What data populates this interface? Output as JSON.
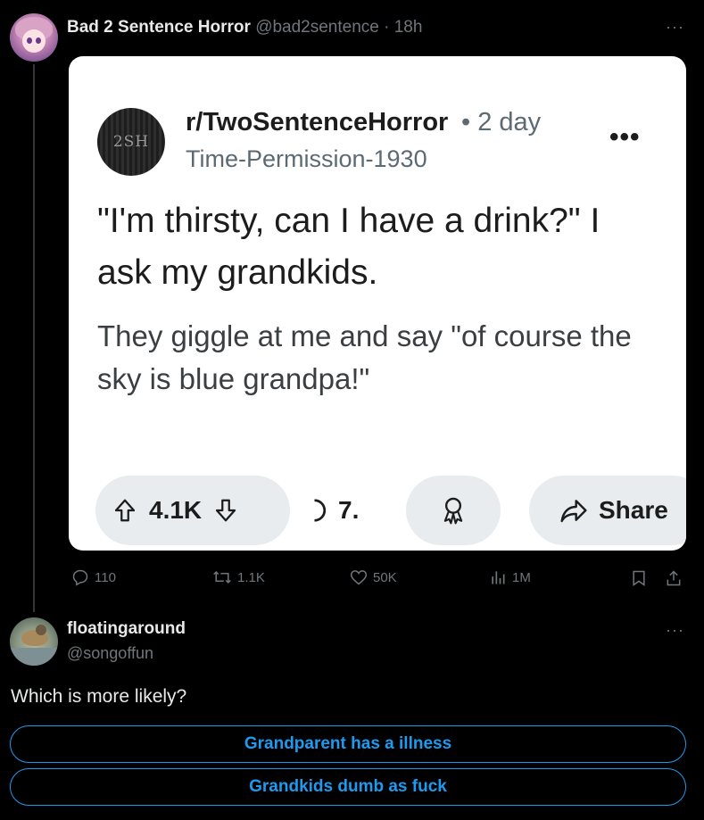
{
  "tweet": {
    "display_name": "Bad 2 Sentence Horror",
    "meta": "@bad2sentence · 18h",
    "more_label": "···",
    "image_card": {
      "subreddit": "r/TwoSentenceHorror",
      "time": "• 2 day",
      "username": "Time-Permission-1930",
      "icon_text": "2SH",
      "more_label": "•••",
      "title": "\"I'm thirsty, can I have a drink?\" I ask my grandkids.",
      "body": "They giggle at me and say \"of course the sky is blue grandpa!\"",
      "vote_count": "4.1K",
      "comment_count": "7.",
      "share_label": "Share"
    },
    "actions": {
      "replies": "110",
      "retweets": "1.1K",
      "likes": "50K",
      "views": "1M"
    }
  },
  "reply": {
    "display_name": "floatingaround",
    "handle": "@songoffun",
    "more_label": "···",
    "text": "Which is more likely?",
    "poll_options": [
      "Grandparent has a illness",
      "Grandkids dumb as fuck"
    ]
  },
  "colors": {
    "background": "#000000",
    "accent": "#1d9bf0",
    "muted": "#71767b",
    "text": "#e7e9ea"
  }
}
